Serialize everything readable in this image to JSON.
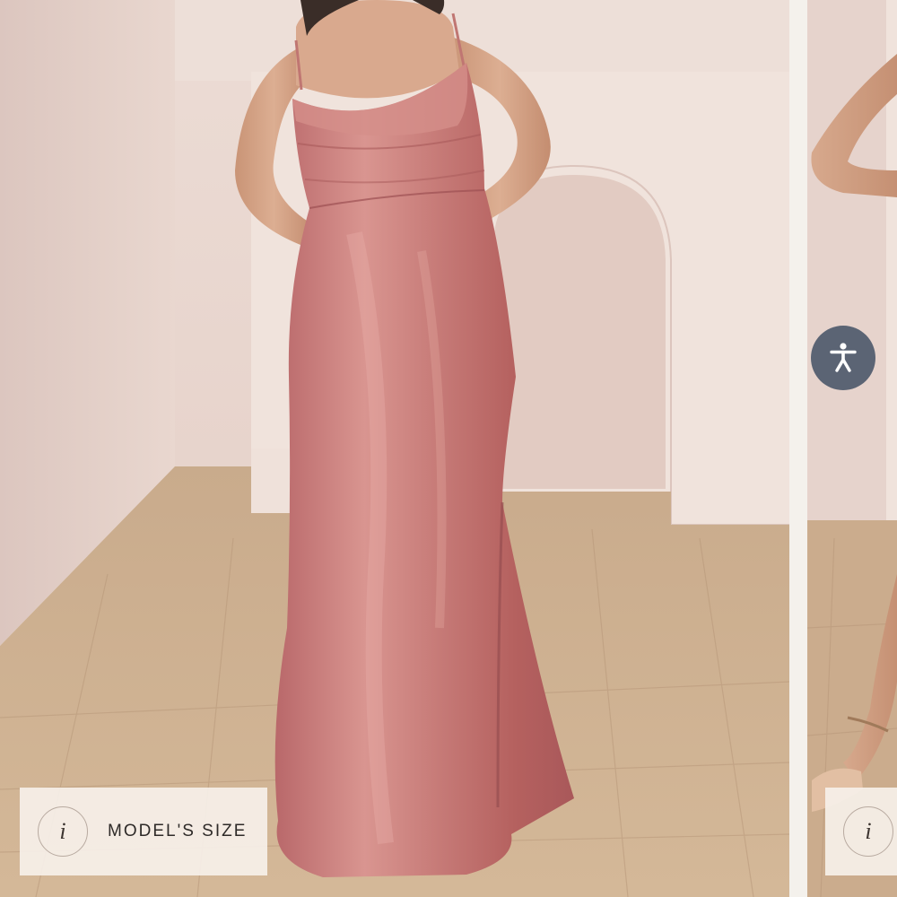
{
  "gallery": {
    "slides": [
      {
        "image_alt": "Model wearing a long rose satin cowl-neck slip dress with side slit",
        "badge": {
          "icon": "info-icon",
          "glyph": "i",
          "label": "MODEL'S SIZE"
        }
      },
      {
        "image_alt": "Model wearing rose satin dress with strappy heels",
        "badge": {
          "icon": "info-icon",
          "glyph": "i",
          "label": ""
        }
      }
    ]
  },
  "accessibility": {
    "icon": "accessibility-person-icon",
    "color": "#5b6474"
  },
  "colors": {
    "dress": "#c77a78",
    "wall": "#e7d3cc",
    "floor": "#c9a98a",
    "badge_bg": "#f6f0e9"
  }
}
